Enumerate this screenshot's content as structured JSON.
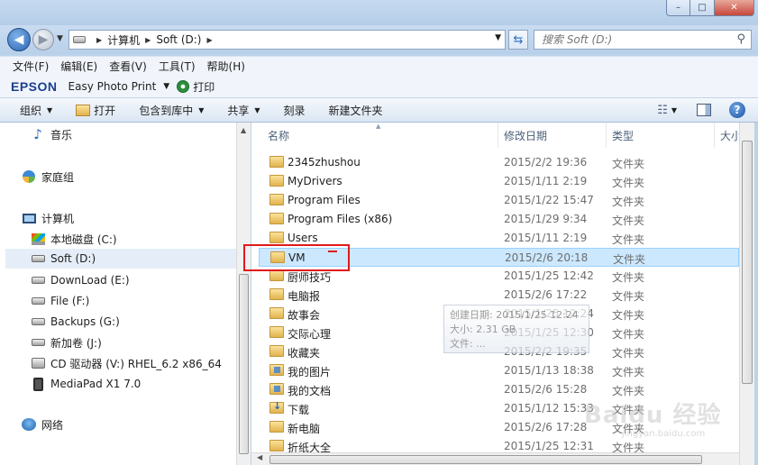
{
  "window": {
    "controls": {
      "minimize": "–",
      "maximize": "□",
      "close": "✕"
    }
  },
  "address": {
    "segments": [
      "计算机",
      "Soft (D:)"
    ],
    "search_placeholder": "搜索 Soft (D:)"
  },
  "menu": [
    "文件(F)",
    "编辑(E)",
    "查看(V)",
    "工具(T)",
    "帮助(H)"
  ],
  "epson": {
    "logo": "EPSON",
    "app": "Easy Photo Print",
    "print": "打印"
  },
  "toolbar": {
    "organize": "组织",
    "open": "打开",
    "include": "包含到库中",
    "share": "共享",
    "burn": "刻录",
    "new_folder": "新建文件夹"
  },
  "nav": {
    "music": "音乐",
    "homegroup": "家庭组",
    "computer": "计算机",
    "drives": [
      "本地磁盘 (C:)",
      "Soft (D:)",
      "DownLoad (E:)",
      "File (F:)",
      "Backups (G:)",
      "新加卷 (J:)",
      "CD 驱动器 (V:) RHEL_6.2 x86_64",
      "MediaPad X1 7.0"
    ],
    "network": "网络"
  },
  "columns": {
    "name": "名称",
    "modified": "修改日期",
    "type": "类型",
    "size": "大小"
  },
  "files": [
    {
      "name": "2345zhushou",
      "date": "2015/2/2 19:36",
      "type": "文件夹"
    },
    {
      "name": "MyDrivers",
      "date": "2015/1/11 2:19",
      "type": "文件夹"
    },
    {
      "name": "Program Files",
      "date": "2015/1/22 15:47",
      "type": "文件夹"
    },
    {
      "name": "Program Files (x86)",
      "date": "2015/1/29 9:34",
      "type": "文件夹"
    },
    {
      "name": "Users",
      "date": "2015/1/11 2:19",
      "type": "文件夹"
    },
    {
      "name": "VM",
      "date": "2015/2/6 20:18",
      "type": "文件夹"
    },
    {
      "name": "厨师技巧",
      "date": "2015/1/25 12:42",
      "type": "文件夹"
    },
    {
      "name": "电脑报",
      "date": "2015/2/6 17:22",
      "type": "文件夹"
    },
    {
      "name": "故事会",
      "date": "2015/1/25 12:24",
      "type": "文件夹"
    },
    {
      "name": "交际心理",
      "date": "2015/1/25 12:30",
      "type": "文件夹"
    },
    {
      "name": "收藏夹",
      "date": "2015/2/2 19:35",
      "type": "文件夹"
    },
    {
      "name": "我的图片",
      "date": "2015/1/13 18:38",
      "type": "文件夹"
    },
    {
      "name": "我的文档",
      "date": "2015/2/6 15:28",
      "type": "文件夹"
    },
    {
      "name": "下载",
      "date": "2015/1/12 15:33",
      "type": "文件夹"
    },
    {
      "name": "新电脑",
      "date": "2015/2/6 17:28",
      "type": "文件夹"
    },
    {
      "name": "折纸大全",
      "date": "2015/1/25 12:31",
      "type": "文件夹"
    }
  ],
  "tooltip": [
    "创建日期: 2015/1/25 12:24",
    "大小: 2.31 GB",
    "文件: ..."
  ],
  "watermark": {
    "main": "Baidu 经验",
    "sub": "jingyan.baidu.com"
  }
}
